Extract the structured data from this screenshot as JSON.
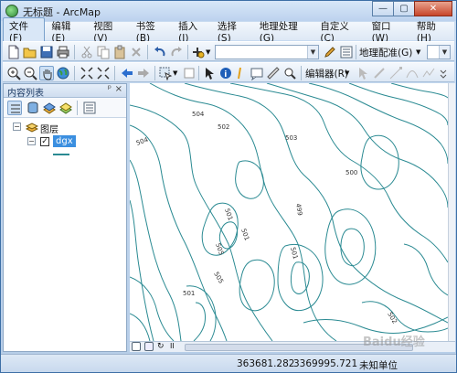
{
  "window": {
    "title": "无标题 - ArcMap"
  },
  "menu": [
    {
      "label": "文件(F)",
      "active": true
    },
    {
      "label": "编辑(E)"
    },
    {
      "label": "视图(V)"
    },
    {
      "label": "书签(B)"
    },
    {
      "label": "插入(I)"
    },
    {
      "label": "选择(S)"
    },
    {
      "label": "地理处理(G)"
    },
    {
      "label": "自定义(C)"
    },
    {
      "label": "窗口(W)"
    },
    {
      "label": "帮助(H)"
    }
  ],
  "toolbar": {
    "georef_label": "地理配准(G)",
    "editor_label": "编辑器(R)",
    "scale_value": ""
  },
  "toc": {
    "title": "内容列表",
    "pin": "ᵖ",
    "close": "×",
    "group_label": "图层",
    "layer_label": "dgx"
  },
  "map": {
    "contour_labels": [
      "504",
      "502",
      "504",
      "503",
      "500",
      "499",
      "501",
      "501",
      "505",
      "501",
      "505",
      "501",
      "502"
    ]
  },
  "status": {
    "x": "363681.282",
    "y": "3369995.721",
    "units": "未知单位"
  },
  "watermark": "Baidu经验"
}
